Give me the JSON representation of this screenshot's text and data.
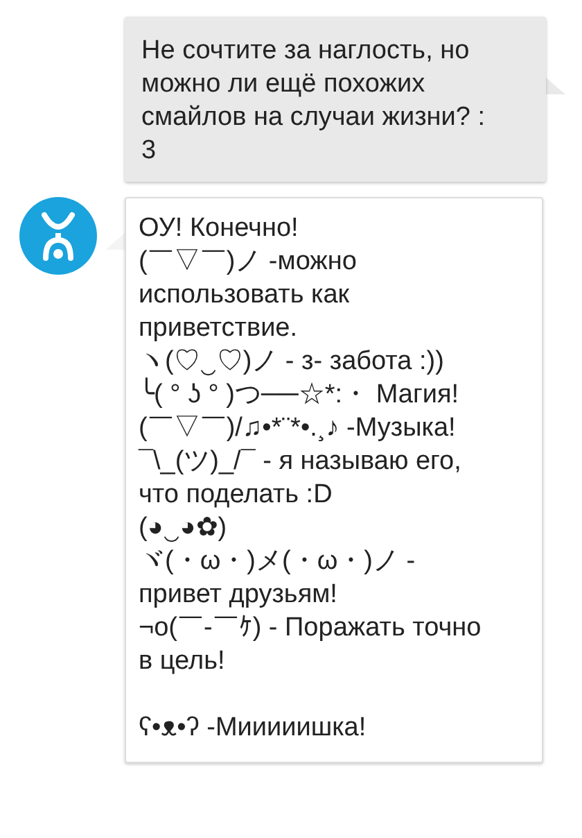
{
  "messages": [
    {
      "kind": "outgoing",
      "paragraphs": [
        [
          "Не сочтите за наглость,  но",
          "можно ли ещё похожих",
          "смайлов на случаи жизни?  :",
          "3"
        ]
      ]
    },
    {
      "kind": "incoming",
      "paragraphs": [
        [
          "ОУ! Конечно!",
          "(￣▽￣)ノ -можно",
          "использовать как",
          "приветствие.",
          "ヽ(♡‿♡)ノ - з- забота :))",
          "╰( ° ʖ ° )つ──☆*:・ Магия!",
          "(￣▽￣)/♫•*¨*•.¸♪ -Музыка!",
          "¯\\_(ツ)_/¯ - я называю его,",
          "что поделать  :D",
          "(◕‿◕✿)",
          "ヾ(・ω・)メ(・ω・)ノ -",
          "привет друзьям!",
          "¬o(￣-￣ｹ) - Поражать точно",
          "в цель!"
        ],
        [
          "ʕ•ᴥ•ʔ -Мииииишка!"
        ]
      ]
    }
  ]
}
